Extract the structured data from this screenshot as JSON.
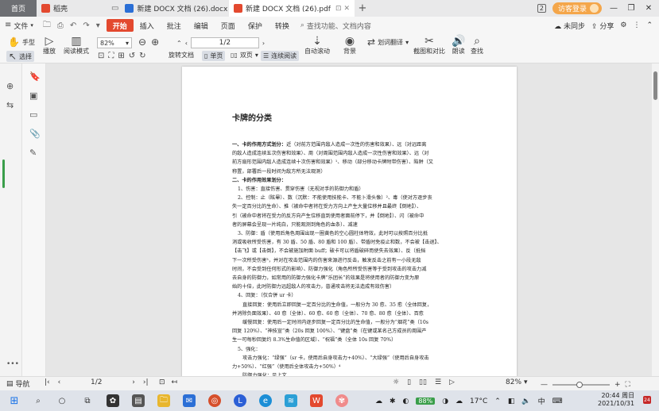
{
  "tabs": [
    {
      "label": "首页",
      "icon": "home-icon"
    },
    {
      "label": "稻壳",
      "icon": "docer-icon"
    },
    {
      "label": "新建 DOCX 文档 (26).docx",
      "icon": "word-doc-icon"
    },
    {
      "label": "新建 DOCX 文档 (26).pdf",
      "icon": "pdf-doc-icon"
    }
  ],
  "titlebar": {
    "badge": "2",
    "login": "访客登录"
  },
  "menu": {
    "file": "文件",
    "items": [
      "开始",
      "插入",
      "批注",
      "编辑",
      "页面",
      "保护",
      "转换"
    ],
    "active": "开始",
    "search": "查找功能、文档内容",
    "unsync": "未同步",
    "share": "分享"
  },
  "ribbon": {
    "hand": "手型",
    "select": "选择",
    "play": "播放",
    "read_mode": "阅读模式",
    "zoom": "82%",
    "page": "1/2",
    "rotate": "旋转文档",
    "single": "单页",
    "double": "双页",
    "continuous": "连续阅读",
    "auto_scroll": "自动滚动",
    "background": "背景",
    "translate": "划词翻译",
    "screenshot": "截图和对比",
    "read_aloud": "朗读",
    "find": "查找"
  },
  "doc": {
    "title": "卡牌的分类",
    "lines": [
      {
        "t": "一、卡的作用方式划分：",
        "b": true,
        "rest": "近（对前方范围内敌人造成一次性的伤害和效果）、远（对远距离"
      },
      {
        "t": "的敌人造成连续五次伤害和效果）、周（对周围范围内敌人造成一次性伤害和效果）、远（对",
        "b": false
      },
      {
        "t": "前方扇形范围内敌人造成连续十次伤害和效果）¹、移动（部分移动卡牌附带伤害）、陷阱（又",
        "b": false
      },
      {
        "t": "称置，部署后一段时间为敌方所无法观测）",
        "b": false
      },
      {
        "t": "二、卡的作用效果划分：",
        "b": true
      },
      {
        "t": "1、伤害：直接伤害、贯穿伤害（无视对手的防御力和盾）",
        "b": false,
        "ind": 1
      },
      {
        "t": "2、控制：止（眩晕）、数（沉默：不能使用技能卡、不能卜滑头像）²、毒（使对方逐步丧",
        "b": false,
        "ind": 1
      },
      {
        "t": "失一定百分比的生命）、推（被命中者将在受力方向上产生大量位移并且最终【倒地】）、",
        "b": false
      },
      {
        "t": "引（被命中者将在受力的反方向产生位移直到使用者面前停下，并【倒地】）、闪（被命中",
        "b": false
      },
      {
        "t": "者的屏幕会呈现一片纯白，只能观测到角色的血条）、减速",
        "b": false
      },
      {
        "t": "3、防御：盾（使用后角色周围出现一圈黄色的空心圆柱体特效，此时可以按照百分比抵",
        "b": false,
        "ind": 1
      },
      {
        "t": "消或吸收所受伤害，有 30 盾、50 盾、80 盾和 100 盾）、带盾时免疫止和数，不会被【击退】、",
        "b": false
      },
      {
        "t": "【击飞】或【击倒】，不会被施加附面 buff；破卡可以将盾破碎而使失去效果）、反（抵挡",
        "b": false
      },
      {
        "t": "下一次所受伤害³，并对在攻击范围内的伤害来源进行反击，触发反击之前有一小段无敌",
        "b": false
      },
      {
        "t": "时间，不会受到任何形式的影响）、防御力强化（角色所所受伤害等于受到攻击的攻击力减",
        "b": false
      },
      {
        "t": "去自身的防御力，如常用的防御力强化卡牌“乐团长”的效果是将使用者的防御力变为原",
        "b": false
      },
      {
        "t": "始的十倍，此时防御力远超敌人的攻击力，普通攻击将无法造成有效伤害）",
        "b": false
      },
      {
        "t": "4、回复：（仅合併 ur 卡）",
        "b": false,
        "ind": 1
      },
      {
        "t": "直接回复：使用后立即回复一定百分比的生命值，一般分为 30 愈、35 愈（全体回复，",
        "b": false,
        "ind": 2
      },
      {
        "t": "并消除负面效果）、40 愈（全体）、60 愈、60 愈（全体）、70 愈、80 愈（全体）、百愈",
        "b": false
      },
      {
        "t": "缓慢回复：使用后一定时间内逐步回复一定百分比的生命值，一般分为“烟花”类（10s",
        "b": false,
        "ind": 2
      },
      {
        "t": "回复 120%）、“神技宣”类（20s 回复 100%）、“键盘”类（在键或某名己方成员的周围产",
        "b": false
      },
      {
        "t": "生一可每秒回复约 8.3%生命值的区域）、“祝福”类（全体 10s 回复 70%）",
        "b": false
      },
      {
        "t": "5、强化：",
        "b": false,
        "ind": 1
      },
      {
        "t": "攻击力强化：“绿强”（sr 卡，使用后自身攻击力+40%）、“大绿强”（使用后自身攻击",
        "b": false,
        "ind": 2
      },
      {
        "t": "力+50%）、“红强”（使用后全体攻击力+50%）⁴",
        "b": false
      },
      {
        "t": "防御力强化：见上文",
        "b": false,
        "ind": 2
      }
    ]
  },
  "status": {
    "nav": "导航",
    "page": "1/2",
    "zoom": "82%"
  },
  "taskbar": {
    "battery": "88%",
    "weather": "17°C",
    "ime": "中",
    "time": "20:44 周日",
    "date": "2021/10/31",
    "notif": "24"
  },
  "colors": {
    "accent": "#e3492f",
    "login": "#f4a64a",
    "pdf": "#e3492f",
    "word": "#2b6fd6"
  }
}
